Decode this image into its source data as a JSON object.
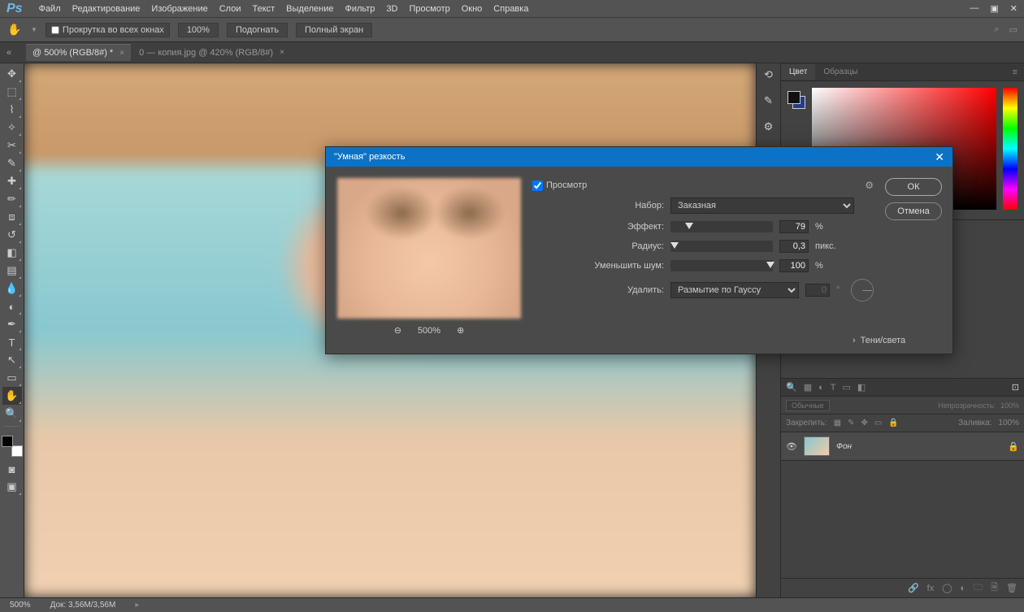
{
  "app": {
    "logo": "Ps"
  },
  "menu": {
    "items": [
      "Файл",
      "Редактирование",
      "Изображение",
      "Слои",
      "Текст",
      "Выделение",
      "Фильтр",
      "3D",
      "Просмотр",
      "Окно",
      "Справка"
    ]
  },
  "options": {
    "scroll_all": "Прокрутка во всех окнах",
    "zoom": "100%",
    "fit": "Подогнать",
    "full": "Полный экран"
  },
  "tabs": {
    "t1": "@ 500% (RGB/8#) *",
    "t2": "0 — копия.jpg @ 420% (RGB/8#)"
  },
  "panels": {
    "color": "Цвет",
    "swatches": "Образцы",
    "blend": "Обычные",
    "opacity_label": "Непрозрачность:",
    "opacity_val": "100%",
    "lock_label": "Закрепить:",
    "fill_label": "Заливка:",
    "fill_val": "100%",
    "layer_name": "Фон"
  },
  "status": {
    "zoom": "500%",
    "doc": "Док: 3,56M/3,56M"
  },
  "dialog": {
    "title": "\"Умная\" резкость",
    "preview_label": "Просмотр",
    "preview_zoom": "500%",
    "preset_label": "Набор:",
    "preset_value": "Заказная",
    "amount_label": "Эффект:",
    "amount_value": "79",
    "amount_unit": "%",
    "radius_label": "Радиус:",
    "radius_value": "0,3",
    "radius_unit": "пикс.",
    "noise_label": "Уменьшить шум:",
    "noise_value": "100",
    "noise_unit": "%",
    "remove_label": "Удалить:",
    "remove_value": "Размытие по Гауссу",
    "angle_value": "0",
    "angle_unit": "°",
    "shadows": "Тени/света",
    "ok": "ОК",
    "cancel": "Отмена"
  }
}
